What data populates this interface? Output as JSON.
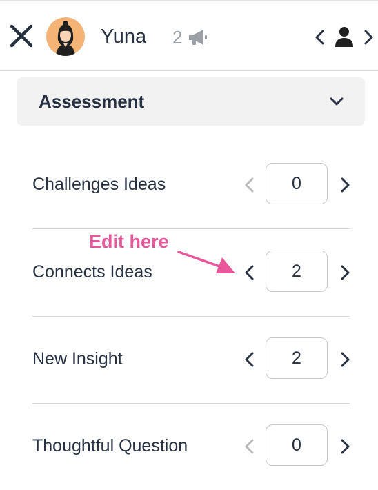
{
  "header": {
    "student_name": "Yuna",
    "shout_count": "2",
    "icons": [
      "close-icon",
      "avatar",
      "megaphone-icon",
      "chevron-left-icon",
      "person-icon",
      "chevron-right-icon"
    ]
  },
  "assessment": {
    "dropdown_label": "Assessment",
    "criteria": [
      {
        "label": "Challenges Ideas",
        "value": "0",
        "prev_enabled": false
      },
      {
        "label": "Connects Ideas",
        "value": "2",
        "prev_enabled": true
      },
      {
        "label": "New Insight",
        "value": "2",
        "prev_enabled": true
      },
      {
        "label": "Thoughtful Question",
        "value": "0",
        "prev_enabled": false
      }
    ]
  },
  "annotation": {
    "text": "Edit here",
    "color": "#e8579a"
  },
  "colors": {
    "text": "#273142",
    "muted": "#9aa0a6",
    "disabled": "#b8b8b8",
    "dropdown_bg": "#f2f2f2",
    "avatar_bg": "#f3b476"
  }
}
